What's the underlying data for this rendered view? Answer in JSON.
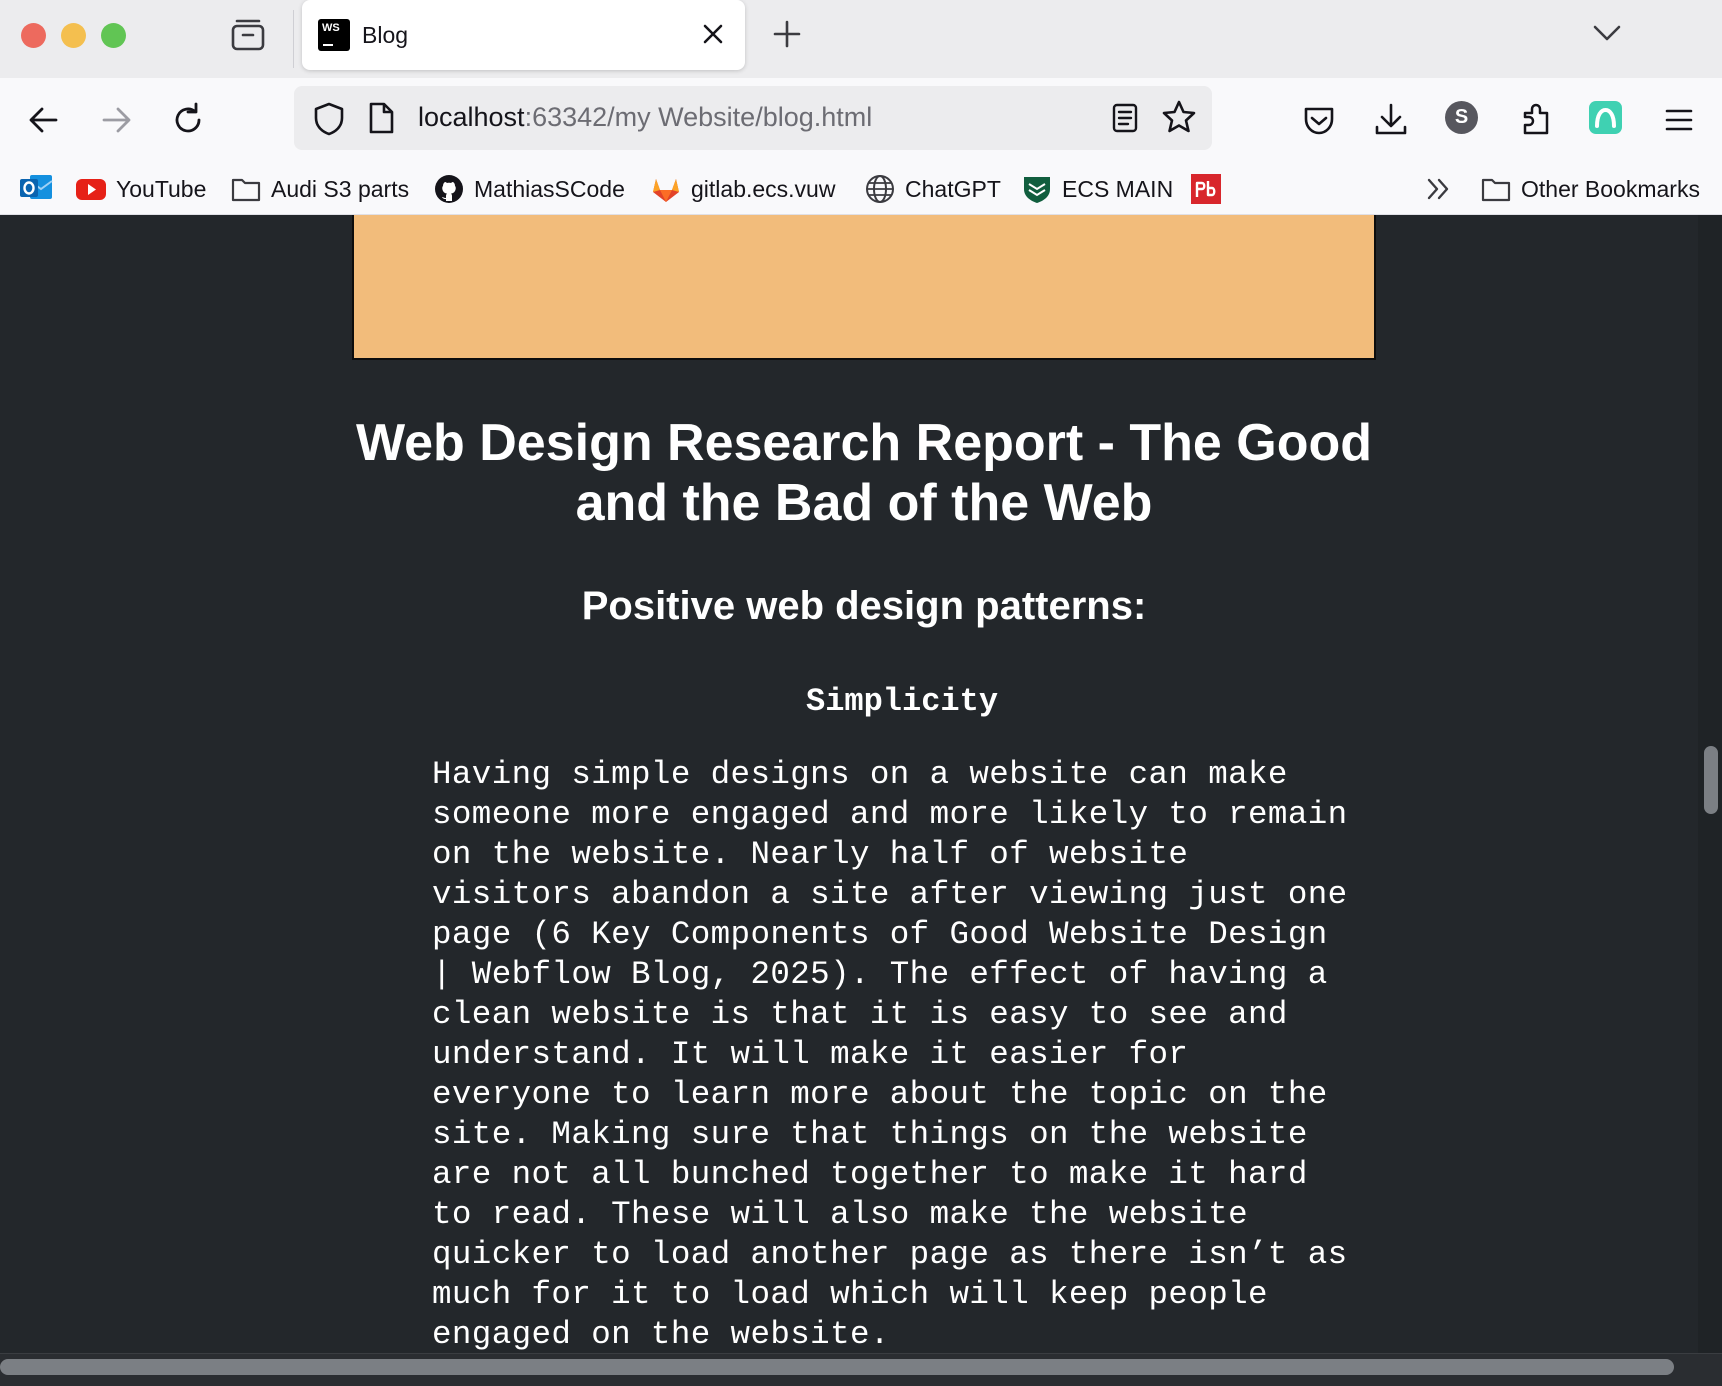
{
  "browser": {
    "tab": {
      "title": "Blog",
      "favicon_text": "WS"
    },
    "url": {
      "host": "localhost",
      "rest": ":63342/my Website/blog.html"
    },
    "profile_initial": "S"
  },
  "bookmarks": [
    {
      "label": "YouTube",
      "icon": "youtube-icon"
    },
    {
      "label": "Audi S3 parts",
      "icon": "folder-icon"
    },
    {
      "label": "MathiasSCode",
      "icon": "github-icon"
    },
    {
      "label": "gitlab.ecs.vuw",
      "icon": "gitlab-icon"
    },
    {
      "label": "ChatGPT",
      "icon": "globe-icon"
    },
    {
      "label": "ECS MAIN",
      "icon": "shield-crest-icon"
    },
    {
      "label": "Other Bookmarks",
      "icon": "folder-icon"
    }
  ],
  "page": {
    "title_line1": "Web Design Research Report - The Good",
    "title_line2": "and the Bad of the Web",
    "section_heading": "Positive web design patterns:",
    "sub_heading": "Simplicity",
    "paragraph_lines": [
      "Having simple designs on a website can make",
      "someone more engaged and more likely to remain",
      "on the website. Nearly half of website",
      "visitors abandon a site after viewing just one",
      "page (6 Key Components of Good Website Design",
      "| Webflow Blog, 2025). The effect of having a",
      "clean website is that it is easy to see and",
      "understand. It will make it easier for",
      "everyone to learn more about the topic on the",
      "site. Making sure that things on the website",
      "are not all bunched together to make it hard",
      "to read. These will also make the website",
      "quicker to load another page as there isn’t as",
      "much for it to load which will keep people",
      "engaged on the website."
    ]
  },
  "colors": {
    "page_background": "#23272b",
    "banner": "#f2bc7b",
    "text": "#ffffff"
  }
}
